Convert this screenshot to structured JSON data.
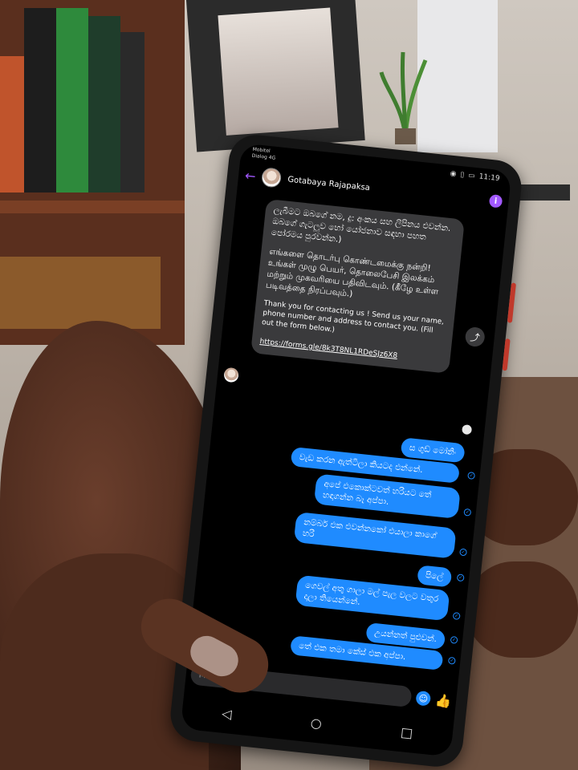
{
  "status": {
    "carrier": "Mobitel",
    "network": "Dialog 4G",
    "time": "11:19"
  },
  "header": {
    "contact_name": "Gotabaya Rajapaksa"
  },
  "incoming": {
    "sinhala": "ලැබීමට ඔබගේ නම, දු: අංකය සහ ලිපිනය එවන්න. ඔබගේ ගැටලුව හෝ යෝජනාව සඳහා පහත පෝරමය පුරවන්න.)",
    "tamil": "எங்களை தொடர்பு கொண்டமைக்கு நன்றி! உங்கள் முழு பெயர், தொலைபேசி இலக்கம் மற்றும் முகவரியை பதிவிடவும். (கீழே உள்ள படிவத்தை நிரப்பவும்.)",
    "english": "Thank you for contacting us ! Send us your name, phone number and address to contact you. (Fill out the form below.)",
    "link": "https://forms.gle/8k3T8NL1RDeSJz6X8"
  },
  "outgoing": [
    "ස ගුඩ් මෝනිං",
    "වැඩ කරන ඇත්ටිලා කියටද එන්නේ.",
    "අපේ එකොක්ටවත් හරියට තේ හඳාගන්න බෑ අප්පා.",
    "නම්බර් එක එවන්නකෝ එයාලා කාගේ හරි",
    "පිලේ",
    "ගෙවල් අතු ගාලා මල් පැල වලට වතුර දාලා තියෙන්නේ.",
    "උයන්නත් පුළුවන්.",
    "තේ එක තමා කේස් එක අප්පා."
  ],
  "composer": {
    "placeholder": "Message"
  },
  "colors": {
    "messenger_blue": "#1f8bff",
    "accent_purple": "#a259ff",
    "incoming_bubble": "#3a3a3c"
  }
}
